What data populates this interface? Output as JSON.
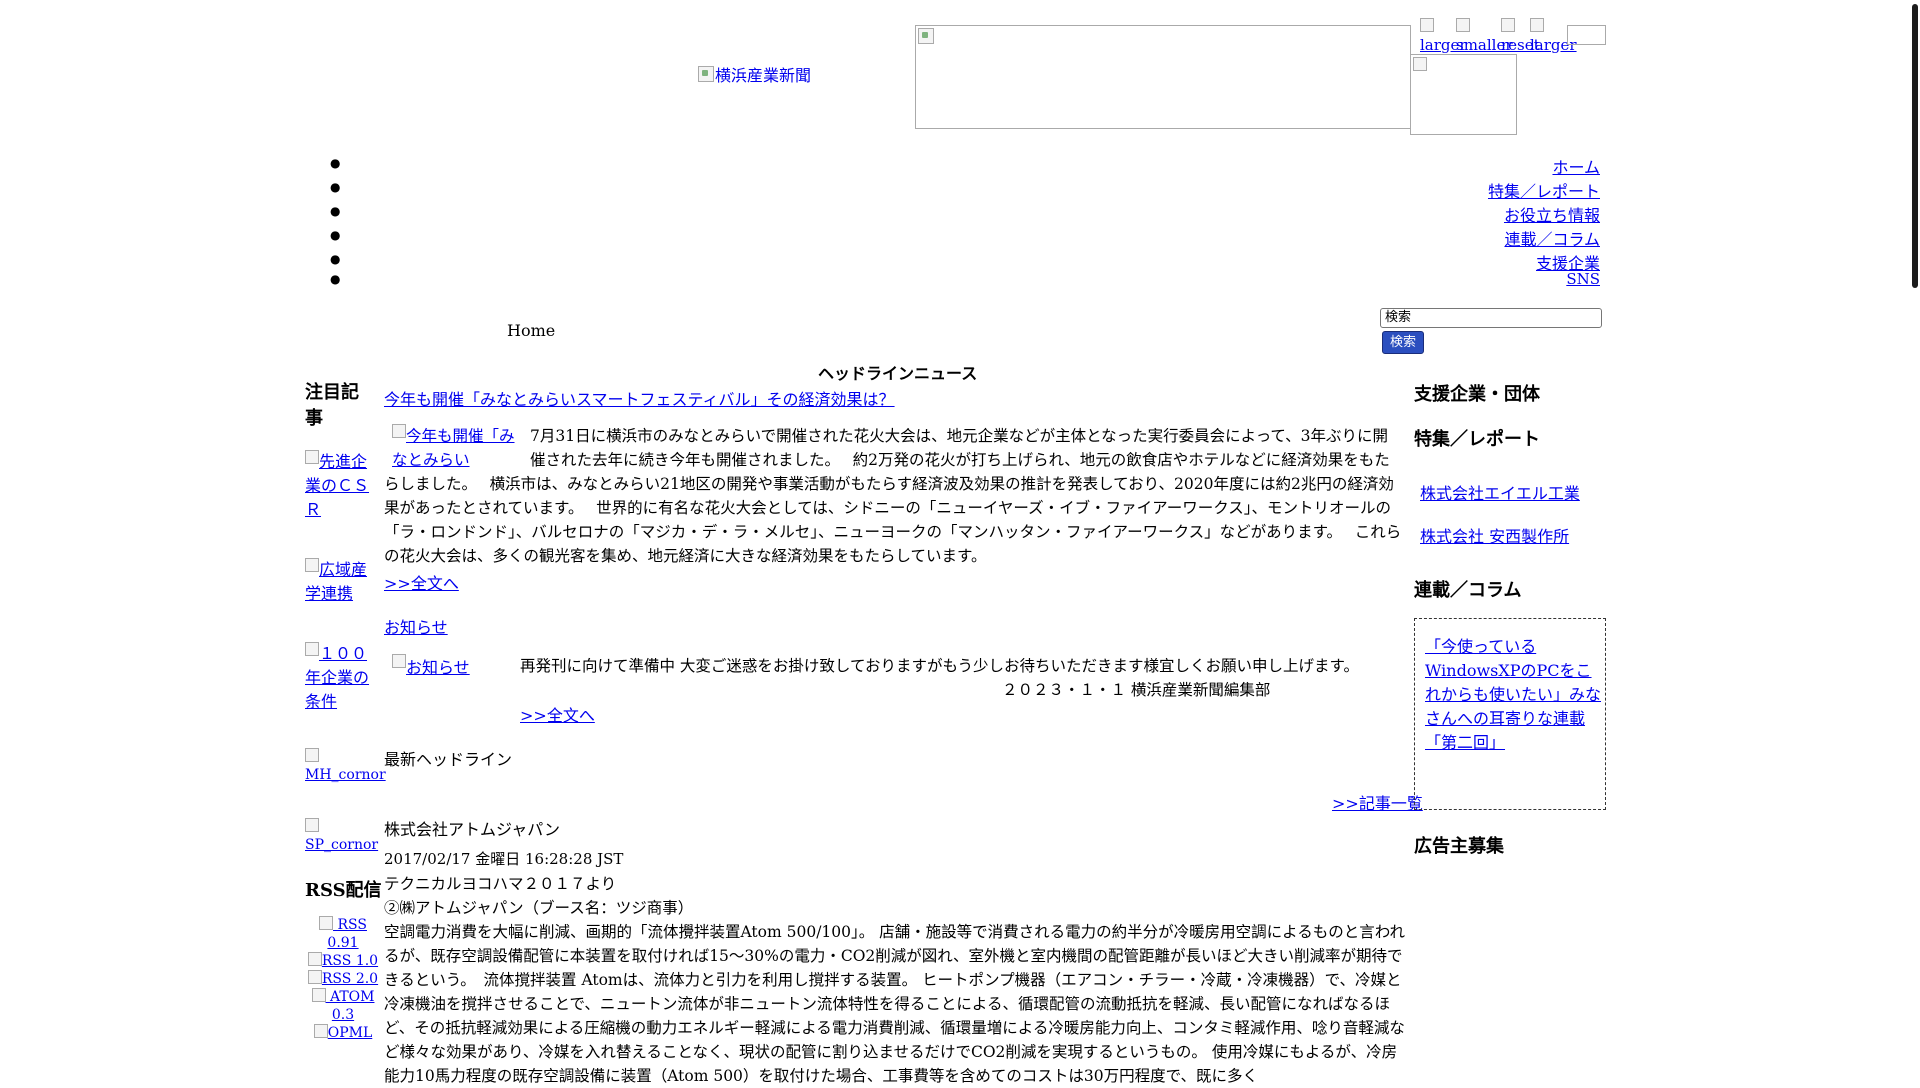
{
  "header": {
    "logo_alt": "横浜産業新聞",
    "font_controls": [
      "larger",
      "smaller",
      "reset",
      "larger"
    ]
  },
  "nav": {
    "items": [
      "ホーム",
      "特集／レポート",
      "お役立ち情報",
      "連載／コラム",
      "支援企業",
      "SNS"
    ]
  },
  "breadcrumb": "Home",
  "search": {
    "value": "検索",
    "button": "検索"
  },
  "headline_section_title": "ヘッドラインニュース",
  "left_sidebar": {
    "title": "注目記事",
    "items": [
      "先進企業のＣＳＲ",
      "広域産学連携",
      "１００年企業の条件",
      "MH_cornor",
      "SP_cornor"
    ],
    "rss_title": "RSS配信",
    "rss_items": [
      "RSS 0.91",
      "RSS 1.0",
      "RSS 2.0",
      "ATOM 0.3",
      "OPML"
    ]
  },
  "main": {
    "article1": {
      "title": "今年も開催「みなとみらいスマートフェスティバル」その経済効果は？",
      "image_alt": "今年も開催「みなとみらい",
      "body": "7月31日に横浜市のみなとみらいで開催された花火大会は、地元企業などが主体となった実行委員会によって、3年ぶりに開催された去年に続き今年も開催されました。　 約2万発の花火が打ち上げられ、地元の飲食店やホテルなどに経済効果をもたらしました。　 横浜市は、みなとみらい21地区の開発や事業活動がもたらす経済波及効果の推計を発表しており、2020年度には約2兆円の経済効果があったとされています。　 世界的に有名な花火大会としては、シドニーの「ニューイヤーズ・イブ・ファイアーワークス」、モントリオールの「ラ・ロンドンド」、バルセロナの「マジカ・デ・ラ・メルセ」、ニューヨークの「マンハッタン・ファイアーワークス」などがあります。　 これらの花火大会は、多くの観光客を集め、地元経済に大きな経済効果をもたらしています。",
      "more": ">>全文へ"
    },
    "notice": {
      "title": "お知らせ",
      "image_alt": "お知らせ",
      "body": "再発刊に向けて準備中 大変ご迷惑をお掛け致しておりますがもう少しお待ちいただきます様宜しくお願い申し上げます。",
      "signature": "２０２３・１・１ 横浜産業新聞編集部",
      "more": ">>全文へ"
    },
    "latest": {
      "title": "最新ヘッドライン",
      "list_link": ">>記事一覧",
      "company": "株式会社アトムジャパン",
      "timestamp": "2017/02/17 金曜日 16:28:28 JST",
      "line1": "テクニカルヨコハマ２０１７より",
      "line2": "②㈱アトムジャパン（ブース名：ツジ商事）",
      "body": "空調電力消費を大幅に削減、画期的「流体攪拌装置Atom 500/100」。 店舗・施設等で消費される電力の約半分が冷暖房用空調によるものと言われるが、既存空調設備配管に本装置を取付ければ15〜30%の電力・CO2削減が図れ、室外機と室内機間の配管距離が長いほど大きい削減率が期待できるという。　流体撹拌装置 Atomは、流体力と引力を利用し撹拌する装置。 ヒートポンプ機器（エアコン・チラー・冷蔵・冷凍機器）で、冷媒と冷凍機油を撹拌させることで、ニュートン流体が非ニュートン流体特性を得ることによる、循環配管の流動抵抗を軽減、長い配管になればなるほど、その抵抗軽減効果による圧縮機の動力エネルギー軽減による電力消費削減、循環量増による冷暖房能力向上、コンタミ軽減作用、唸り音軽減など様々な効果があり、冷媒を入れ替えることなく、現状の配管に割り込ませるだけでCO2削減を実現するというもの。 使用冷媒にもよるが、冷房能力10馬力程度の既存空調設備に装置（Atom 500）を取付けた場合、工事費等を含めてのコストは30万円程度で、既に多く"
    }
  },
  "right_sidebar": {
    "support_title": "支援企業・団体",
    "feature_title": "特集／レポート",
    "companies": [
      "株式会社エイエル工業",
      "株式会社 安西製作所"
    ],
    "column_title": "連載／コラム",
    "column_link": "「今使っているWindowsXPのPCをこれからも使いたい」みなさんへの耳寄りな連載「第二回」",
    "ad_title": "広告主募集"
  }
}
